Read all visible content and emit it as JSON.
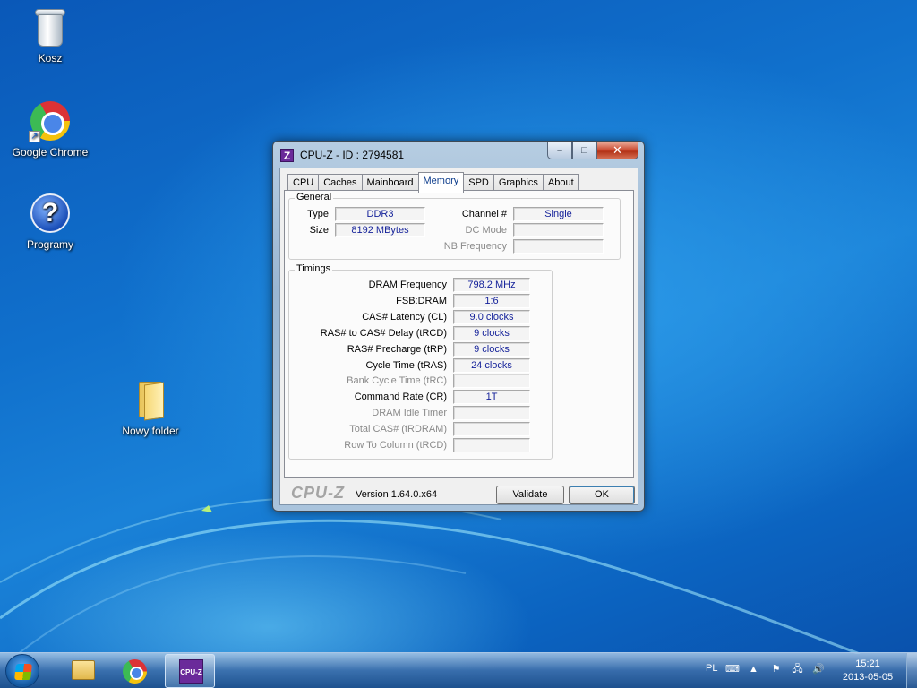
{
  "desktop": {
    "icons": [
      {
        "label": "Kosz"
      },
      {
        "label": "Google Chrome"
      },
      {
        "label": "Programy"
      },
      {
        "label": "Nowy folder"
      }
    ]
  },
  "window": {
    "title": "CPU-Z - ID : 2794581",
    "controls": {
      "minimize": "–",
      "maximize": "□",
      "close": "✕"
    },
    "tabs": [
      "CPU",
      "Caches",
      "Mainboard",
      "Memory",
      "SPD",
      "Graphics",
      "About"
    ],
    "active_tab": "Memory",
    "general": {
      "title": "General",
      "type_label": "Type",
      "type_value": "DDR3",
      "size_label": "Size",
      "size_value": "8192 MBytes",
      "channel_label": "Channel #",
      "channel_value": "Single",
      "dc_mode_label": "DC Mode",
      "dc_mode_value": "",
      "nb_freq_label": "NB Frequency",
      "nb_freq_value": ""
    },
    "timings": {
      "title": "Timings",
      "rows": [
        {
          "label": "DRAM Frequency",
          "value": "798.2 MHz",
          "enabled": true
        },
        {
          "label": "FSB:DRAM",
          "value": "1:6",
          "enabled": true
        },
        {
          "label": "CAS# Latency (CL)",
          "value": "9.0 clocks",
          "enabled": true
        },
        {
          "label": "RAS# to CAS# Delay (tRCD)",
          "value": "9 clocks",
          "enabled": true
        },
        {
          "label": "RAS# Precharge (tRP)",
          "value": "9 clocks",
          "enabled": true
        },
        {
          "label": "Cycle Time (tRAS)",
          "value": "24 clocks",
          "enabled": true
        },
        {
          "label": "Bank Cycle Time (tRC)",
          "value": "",
          "enabled": false
        },
        {
          "label": "Command Rate (CR)",
          "value": "1T",
          "enabled": true
        },
        {
          "label": "DRAM Idle Timer",
          "value": "",
          "enabled": false
        },
        {
          "label": "Total CAS# (tRDRAM)",
          "value": "",
          "enabled": false
        },
        {
          "label": "Row To Column (tRCD)",
          "value": "",
          "enabled": false
        }
      ]
    },
    "footer": {
      "logo": "CPU-Z",
      "version": "Version 1.64.0.x64",
      "validate_label": "Validate",
      "ok_label": "OK"
    }
  },
  "taskbar": {
    "language": "PL",
    "time": "15:21",
    "date": "2013-05-05",
    "tray_icons": [
      "keyboard-icon",
      "show-hidden-icons-icon",
      "action-center-icon",
      "network-icon",
      "volume-icon"
    ]
  }
}
